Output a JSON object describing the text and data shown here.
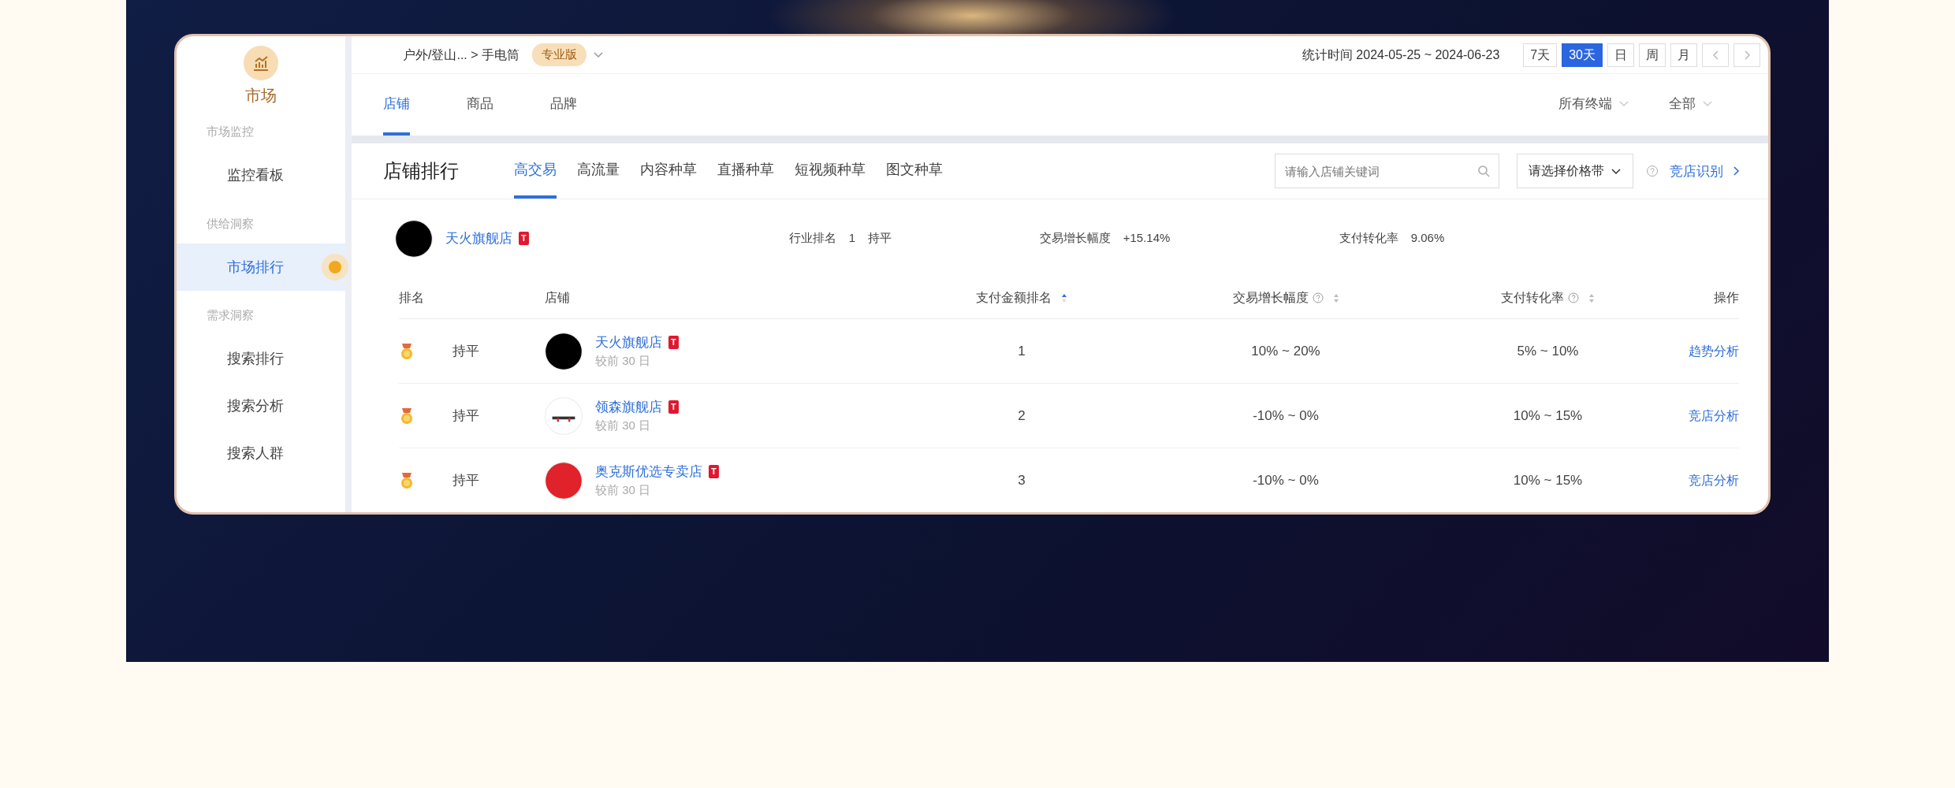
{
  "breadcrumb": {
    "path": "户外/登山... > 手电筒",
    "badge": "专业版"
  },
  "date_range": "统计时间 2024-05-25 ~ 2024-06-23",
  "periods": [
    {
      "label": "7天",
      "selected": false
    },
    {
      "label": "30天",
      "selected": true
    },
    {
      "label": "日",
      "selected": false
    },
    {
      "label": "周",
      "selected": false
    },
    {
      "label": "月",
      "selected": false
    }
  ],
  "tabs": [
    {
      "label": "店铺",
      "selected": true
    },
    {
      "label": "商品",
      "selected": false
    },
    {
      "label": "品牌",
      "selected": false
    }
  ],
  "filters": [
    "所有终端",
    "全部"
  ],
  "sidebar": {
    "title": "市场",
    "groups": [
      {
        "label": "市场监控",
        "items": [
          {
            "label": "监控看板",
            "selected": false
          }
        ]
      },
      {
        "label": "供给洞察",
        "items": [
          {
            "label": "市场排行",
            "selected": true
          }
        ]
      },
      {
        "label": "需求洞察",
        "items": [
          {
            "label": "搜索排行",
            "selected": false
          },
          {
            "label": "搜索分析",
            "selected": false
          },
          {
            "label": "搜索人群",
            "selected": false
          }
        ]
      }
    ]
  },
  "panel": {
    "title": "店铺排行",
    "tabs": [
      {
        "label": "高交易",
        "selected": true
      },
      {
        "label": "高流量",
        "selected": false
      },
      {
        "label": "内容种草",
        "selected": false
      },
      {
        "label": "直播种草",
        "selected": false
      },
      {
        "label": "短视频种草",
        "selected": false
      },
      {
        "label": "图文种草",
        "selected": false
      }
    ],
    "search": {
      "placeholder": "请输入店铺关键词"
    },
    "price_select": "请选择价格带",
    "link": "竞店识别"
  },
  "my_store": {
    "name": "天火旗舰店",
    "badge": "T",
    "color": "#000000",
    "stats": [
      {
        "label": "行业排名",
        "value": "1",
        "extra": "持平"
      },
      {
        "label": "交易增长幅度",
        "value": "+15.14%"
      },
      {
        "label": "支付转化率",
        "value": "9.06%"
      }
    ]
  },
  "table": {
    "columns": [
      {
        "label": "排名"
      },
      {
        "label": "店铺"
      },
      {
        "label": "支付金额排名",
        "sorted": true
      },
      {
        "label": "交易增长幅度",
        "help": true,
        "sorted": false
      },
      {
        "label": "支付转化率",
        "help": true,
        "sorted": false
      },
      {
        "label": "操作"
      }
    ],
    "rows": [
      {
        "trend": "持平",
        "store": "天火旗舰店",
        "badge": "T",
        "note": "较前 30 日",
        "color": "#000000",
        "pay_rank": "1",
        "growth": "10% ~ 20%",
        "conversion": "5% ~ 10%",
        "action": "趋势分析"
      },
      {
        "trend": "持平",
        "store": "领森旗舰店",
        "badge": "T",
        "note": "较前 30 日",
        "color": "#ffffff",
        "pay_rank": "2",
        "growth": "-10% ~ 0%",
        "conversion": "10% ~ 15%",
        "action": "竞店分析"
      },
      {
        "trend": "持平",
        "store": "奥克斯优选专卖店",
        "badge": "T",
        "note": "较前 30 日",
        "color": "#e0222a",
        "pay_rank": "3",
        "growth": "-10% ~ 0%",
        "conversion": "10% ~ 15%",
        "action": "竞店分析"
      }
    ]
  }
}
